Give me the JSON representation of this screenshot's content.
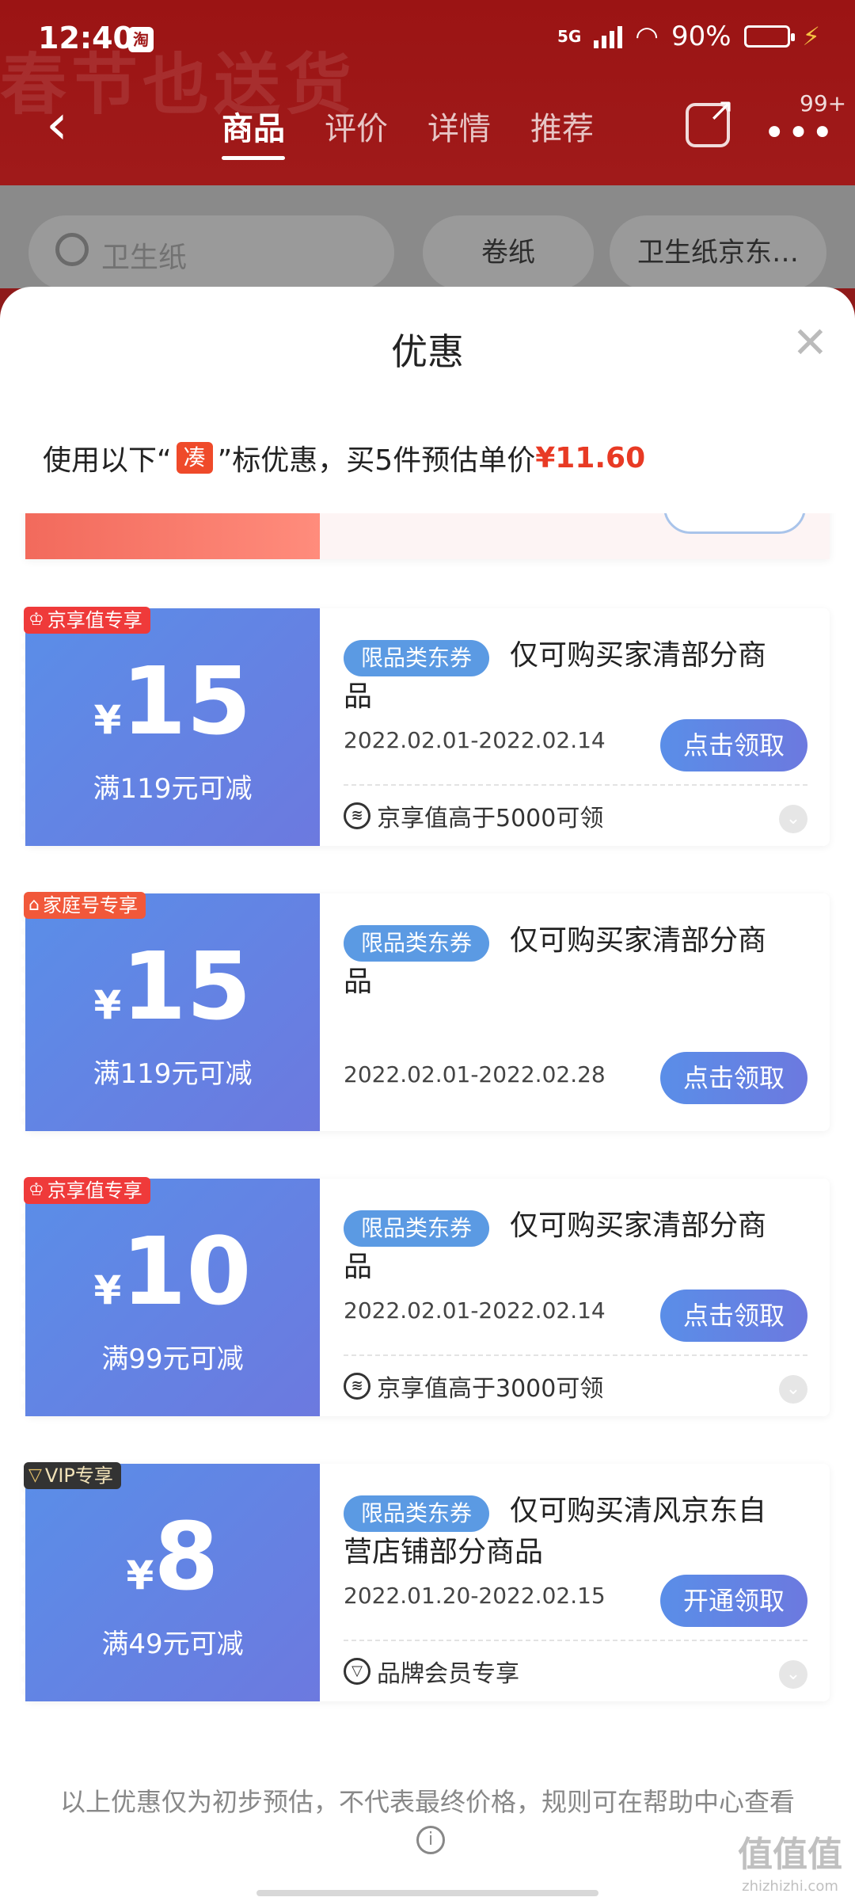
{
  "status_bar": {
    "time": "12:40",
    "app_icon": "淘",
    "network": "5G",
    "battery": "90%"
  },
  "header": {
    "banner_text": "春节也送货",
    "tabs": [
      {
        "label": "商品",
        "active": true
      },
      {
        "label": "评价",
        "active": false
      },
      {
        "label": "详情",
        "active": false
      },
      {
        "label": "推荐",
        "active": false
      }
    ],
    "more_badge": "99+"
  },
  "search": {
    "placeholder": "卫生纸",
    "chips": [
      "卷纸",
      "卫生纸京东…"
    ]
  },
  "sheet": {
    "title": "优惠",
    "summary": {
      "prefix": "使用以下“",
      "badge": "凑",
      "suffix": "”标优惠，买5件预估单价",
      "price": "¥11.60"
    },
    "coupons": [
      {
        "tag": "京享值专享",
        "tag_style": "red",
        "tag_icon": "award-icon",
        "currency": "¥",
        "amount": "15",
        "condition": "满119元可减",
        "type": "限品类东券",
        "description": "仅可购买家清部分商品",
        "date": "2022.02.01-2022.02.14",
        "button": "点击领取",
        "requirement": "京享值高于5000可领"
      },
      {
        "tag": "家庭号专享",
        "tag_style": "orange",
        "tag_icon": "home-icon",
        "currency": "¥",
        "amount": "15",
        "condition": "满119元可减",
        "type": "限品类东券",
        "description": "仅可购买家清部分商品",
        "date": "2022.02.01-2022.02.28",
        "button": "点击领取",
        "requirement": ""
      },
      {
        "tag": "京享值专享",
        "tag_style": "red",
        "tag_icon": "award-icon",
        "currency": "¥",
        "amount": "10",
        "condition": "满99元可减",
        "type": "限品类东券",
        "description": "仅可购买家清部分商品",
        "date": "2022.02.01-2022.02.14",
        "button": "点击领取",
        "requirement": "京享值高于3000可领"
      },
      {
        "tag": "VIP专享",
        "tag_style": "dark",
        "tag_icon": "vip-icon",
        "currency": "¥",
        "amount": "8",
        "condition": "满49元可减",
        "type": "限品类东券",
        "description": "仅可购买清风京东自营店铺部分商品",
        "date": "2022.01.20-2022.02.15",
        "button": "开通领取",
        "requirement": "品牌会员专享"
      }
    ],
    "disclaimer": "以上优惠仅为初步预估，不代表最终价格，规则可在帮助中心查看"
  },
  "watermark": {
    "main": "值值值",
    "sub": "zhizhizhi.com"
  },
  "colors": {
    "header_red": "#a01a1a",
    "coupon_blue": "#5a8ee8",
    "price_red": "#e83a24"
  }
}
